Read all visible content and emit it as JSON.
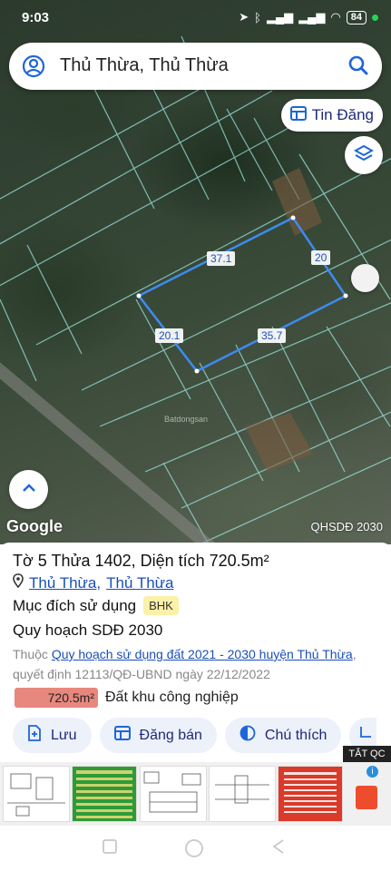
{
  "status_bar": {
    "time": "9:03",
    "battery": "84"
  },
  "search": {
    "query": "Thủ Thừa, Thủ Thừa"
  },
  "map": {
    "tin_dang_label": "Tin Đăng",
    "google_logo": "Google",
    "layer_label": "QHSDĐ 2030",
    "watermark": "Batdongsan",
    "edges": {
      "top": "37.1",
      "right": "20",
      "left": "20.1",
      "bottom": "35.7"
    }
  },
  "info": {
    "title": "Tờ 5 Thửa 1402, Diện tích 720.5m²",
    "location_district": "Thủ Thừa",
    "location_separator": ",",
    "location_commune": "Thủ Thừa",
    "purpose_label": "Mục đích sử dụng",
    "purpose_code": "BHK",
    "plan_heading": "Quy hoạch SDĐ 2030",
    "plan_prefix": "Thuộc",
    "plan_link": "Quy hoạch sử dụng đất 2021 - 2030 huyện Thủ Thừa",
    "plan_suffix": ", quyết định 12113/QĐ-UBND ngày 22/12/2022",
    "area_value": "720.5m²",
    "area_type": "Đất khu công nghiệp"
  },
  "actions": [
    {
      "label": "Lưu",
      "icon": "save-add-icon"
    },
    {
      "label": "Đăng bán",
      "icon": "listing-icon"
    },
    {
      "label": "Chú thích",
      "icon": "legend-icon"
    }
  ],
  "ad": {
    "close_label": "TẮT QC"
  },
  "colors": {
    "plot_outline": "#3d8bf2",
    "accent": "#1e2a78",
    "area_badge": "#e8877d",
    "badge_bhk": "#fbf1a7"
  }
}
